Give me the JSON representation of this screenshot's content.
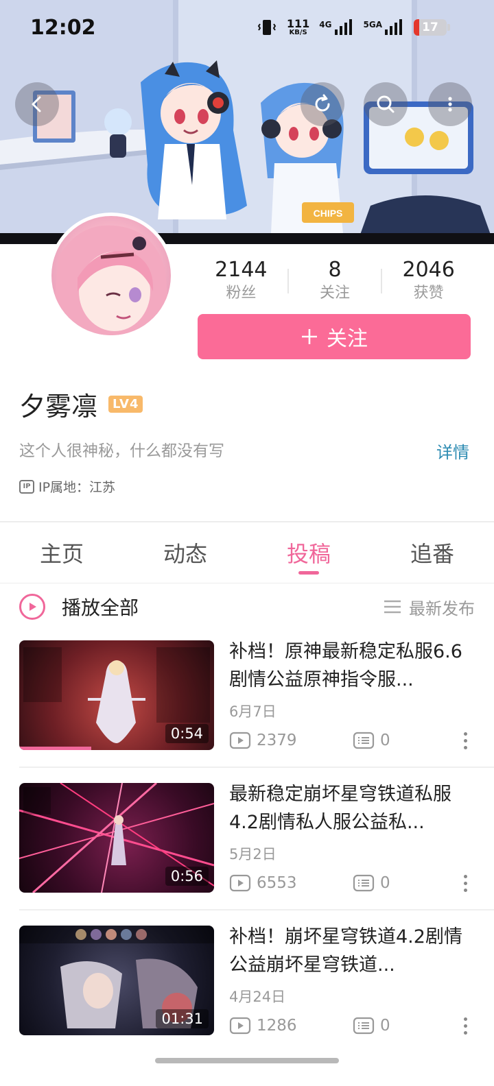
{
  "status_bar": {
    "time": "12:02",
    "net_speed_value": "111",
    "net_speed_unit": "KB/S",
    "signal1_label": "4G",
    "signal2_label": "5GA",
    "battery_level": "17",
    "icons": [
      "vibrate-icon",
      "signal-icon",
      "battery-icon"
    ]
  },
  "header_buttons": {
    "back": "back-icon",
    "refresh": "refresh-icon",
    "search": "search-icon",
    "more": "more-vertical-icon"
  },
  "banner": {
    "chips_text": "CHIPS"
  },
  "profile": {
    "stats": [
      {
        "value": "2144",
        "label": "粉丝"
      },
      {
        "value": "8",
        "label": "关注"
      },
      {
        "value": "2046",
        "label": "获赞"
      }
    ],
    "follow_label": "关注",
    "username": "夕雾凛",
    "level": "LV4",
    "bio": "这个人很神秘，什么都没有写",
    "detail_link": "详情",
    "ip_icon_text": "IP",
    "ip_location": "IP属地：江苏"
  },
  "tabs": [
    {
      "label": "主页",
      "active": false
    },
    {
      "label": "动态",
      "active": false
    },
    {
      "label": "投稿",
      "active": true
    },
    {
      "label": "追番",
      "active": false
    }
  ],
  "list_header": {
    "play_all": "播放全部",
    "sort": "最新发布"
  },
  "videos": [
    {
      "title": "补档！原神最新稳定私服6.6剧情公益原神指令服...",
      "duration": "0:54",
      "date": "6月7日",
      "plays": "2379",
      "comments": "0",
      "watched_fraction": 0.37
    },
    {
      "title": "最新稳定崩坏星穹铁道私服4.2剧情私人服公益私...",
      "duration": "0:56",
      "date": "5月2日",
      "plays": "6553",
      "comments": "0",
      "watched_fraction": 0
    },
    {
      "title": "补档！崩坏星穹铁道4.2剧情公益崩坏星穹铁道...",
      "duration": "01:31",
      "date": "4月24日",
      "plays": "1286",
      "comments": "0",
      "watched_fraction": 0
    }
  ],
  "colors": {
    "accent": "#f0679a",
    "follow_button": "#fb6b97",
    "link": "#2c8bb2",
    "level_badge": "#f8b96a",
    "battery_low": "#e4372c"
  }
}
